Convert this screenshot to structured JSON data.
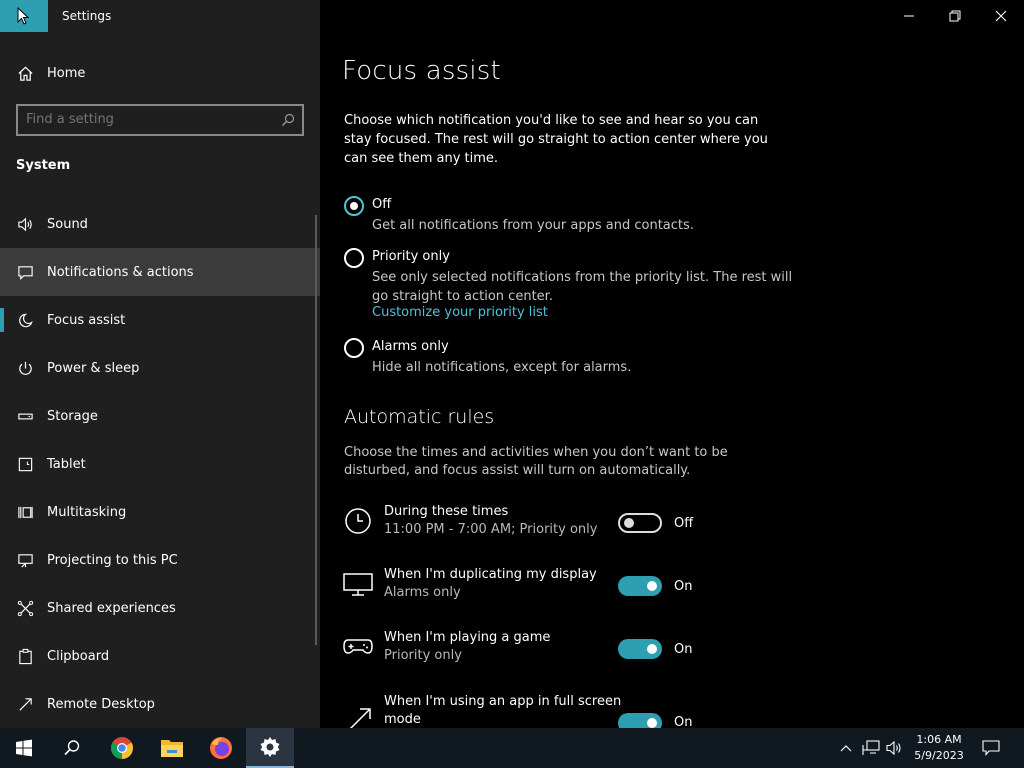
{
  "window": {
    "app_title": "Settings",
    "minimize_glyph": "—",
    "restore_glyph": "❐",
    "close_glyph": "✕"
  },
  "sidebar": {
    "home_label": "Home",
    "search_placeholder": "Find a setting",
    "section_header": "System",
    "items": [
      {
        "label": "Sound",
        "icon": "speaker-icon"
      },
      {
        "label": "Notifications & actions",
        "icon": "notification-icon",
        "state": "hover"
      },
      {
        "label": "Focus assist",
        "icon": "moon-icon",
        "state": "selected"
      },
      {
        "label": "Power & sleep",
        "icon": "power-icon"
      },
      {
        "label": "Storage",
        "icon": "storage-icon"
      },
      {
        "label": "Tablet",
        "icon": "tablet-icon"
      },
      {
        "label": "Multitasking",
        "icon": "multitasking-icon"
      },
      {
        "label": "Projecting to this PC",
        "icon": "projecting-icon"
      },
      {
        "label": "Shared experiences",
        "icon": "shared-icon"
      },
      {
        "label": "Clipboard",
        "icon": "clipboard-icon"
      },
      {
        "label": "Remote Desktop",
        "icon": "remote-desktop-icon"
      }
    ]
  },
  "main": {
    "title": "Focus assist",
    "intro": "Choose which notification you'd like to see and hear so you can stay focused. The rest will go straight to action center where you can see them any time.",
    "options": [
      {
        "label": "Off",
        "desc": "Get all notifications from your apps and contacts.",
        "checked": true
      },
      {
        "label": "Priority only",
        "desc": "See only selected notifications from the priority list. The rest will go straight to action center.",
        "link": "Customize your priority list",
        "checked": false
      },
      {
        "label": "Alarms only",
        "desc": "Hide all notifications, except for alarms.",
        "checked": false
      }
    ],
    "rules_title": "Automatic rules",
    "rules_desc": "Choose the times and activities when you don’t want to be disturbed, and focus assist will turn on automatically.",
    "rules": [
      {
        "title": "During these times",
        "sub": "11:00 PM - 7:00 AM; Priority only",
        "state": "Off",
        "on": false,
        "icon": "clock-icon"
      },
      {
        "title": "When I'm duplicating my display",
        "sub": "Alarms only",
        "state": "On",
        "on": true,
        "icon": "monitor-icon"
      },
      {
        "title": "When I'm playing a game",
        "sub": "Priority only",
        "state": "On",
        "on": true,
        "icon": "gamepad-icon"
      },
      {
        "title": "When I'm using an app in full screen mode",
        "sub": "",
        "state": "On",
        "on": true,
        "icon": "fullscreen-icon"
      }
    ]
  },
  "taskbar": {
    "clock_time": "1:06 AM",
    "clock_date": "5/9/2023",
    "apps": [
      "start-icon",
      "search-icon",
      "chrome-icon",
      "file-explorer-icon",
      "firefox-icon",
      "settings-icon"
    ]
  },
  "colors": {
    "accent": "#2d9fb1",
    "sidebar_bg": "#1f1f1f",
    "link": "#4fc3d7"
  }
}
